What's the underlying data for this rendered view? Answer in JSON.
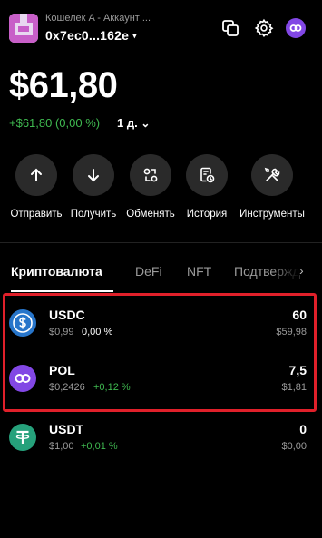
{
  "header": {
    "wallet_subtitle": "Кошелек A - Аккаунт ...",
    "wallet_address": "0x7ec0...162e",
    "address_caret": "▾"
  },
  "balance": {
    "total": "$61,80",
    "change": "+$61,80 (0,00 %)",
    "period": "1 д.",
    "period_caret": "⌄"
  },
  "actions": [
    {
      "label": "Отправить"
    },
    {
      "label": "Получить"
    },
    {
      "label": "Обменять"
    },
    {
      "label": "История"
    },
    {
      "label": "Инструменты"
    }
  ],
  "tabs": [
    {
      "label": "Криптовалюта"
    },
    {
      "label": "DeFi"
    },
    {
      "label": "NFT"
    },
    {
      "label": "Подтвержд"
    }
  ],
  "tab_arrow": "›",
  "tokens": [
    {
      "name": "USDC",
      "price": "$0,99",
      "change": "0,00 %",
      "amount": "60",
      "value": "$59,98",
      "color": "#2775ca"
    },
    {
      "name": "POL",
      "price": "$0,2426",
      "change": "+0,12 %",
      "amount": "7,5",
      "value": "$1,81",
      "color": "#8247e5"
    },
    {
      "name": "USDT",
      "price": "$1,00",
      "change": "+0,01 %",
      "amount": "0",
      "value": "$0,00",
      "color": "#26a17b"
    }
  ],
  "colors": {
    "positive": "#3fb950",
    "highlight": "#e0202a",
    "neutral_change": "#ffffff"
  }
}
